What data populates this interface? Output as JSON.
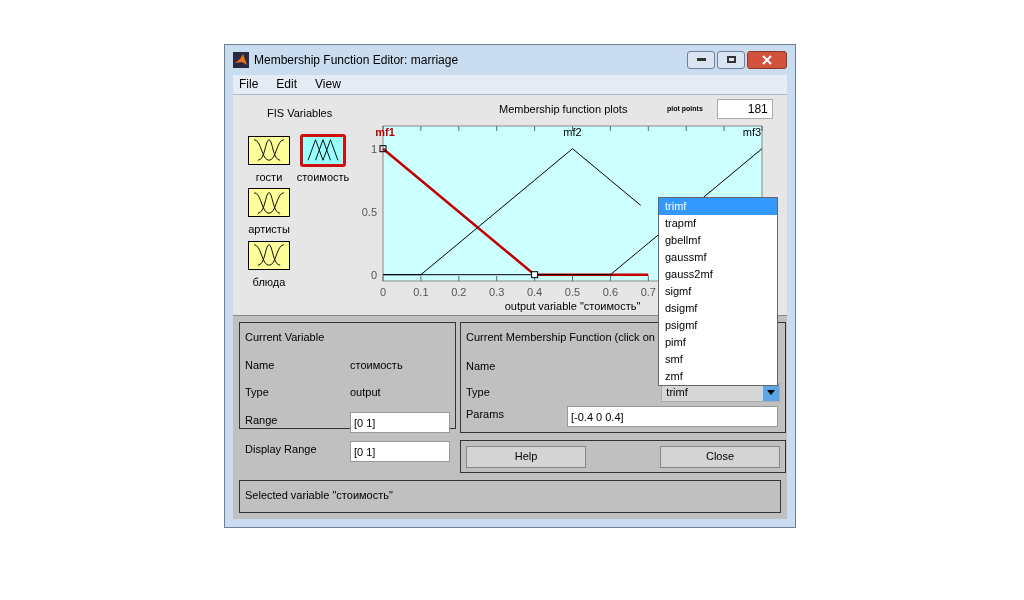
{
  "window": {
    "title": "Membership Function Editor: marriage"
  },
  "menu": [
    "File",
    "Edit",
    "View"
  ],
  "fis_variables": {
    "title": "FIS Variables",
    "items": [
      {
        "name": "гости",
        "kind": "input",
        "selected": false
      },
      {
        "name": "стоимость",
        "kind": "output",
        "selected": true
      },
      {
        "name": "артисты",
        "kind": "input",
        "selected": false
      },
      {
        "name": "блюда",
        "kind": "input",
        "selected": false
      }
    ]
  },
  "plot": {
    "title": "Membership function plots",
    "plot_points_label": "plot points",
    "plot_points": "181",
    "chart_data": {
      "type": "line",
      "xlabel": "output variable \"стоимость\"",
      "x": [
        0,
        0.1,
        0.4,
        0.5,
        0.6,
        0.68,
        0.7,
        0.9,
        1
      ],
      "xlim": [
        0,
        1
      ],
      "ylim": [
        -0.05,
        1.18
      ],
      "xticks": [
        0,
        0.1,
        0.2,
        0.3,
        0.4,
        0.5,
        0.6,
        0.7
      ],
      "yticks": [
        0,
        0.5,
        1
      ],
      "series": [
        {
          "name": "mf1",
          "color": "#c00000",
          "values": [
            1,
            0.75,
            0,
            0,
            0,
            0,
            0,
            null,
            null
          ]
        },
        {
          "name": "mf2",
          "color": "#000000",
          "values": [
            0,
            0,
            0.75,
            1,
            0.75,
            0.55,
            null,
            null,
            null
          ]
        },
        {
          "name": "mf3",
          "color": "#000000",
          "values": [
            0,
            0,
            0,
            0,
            0,
            0.2,
            0.25,
            0.75,
            1
          ]
        }
      ]
    },
    "curves": [
      {
        "selected": true
      },
      {
        "selected": false
      },
      {
        "selected": false
      }
    ]
  },
  "current_variable": {
    "title": "Current Variable",
    "rows": [
      {
        "label": "Name",
        "value": "стоимость",
        "kind": "text"
      },
      {
        "label": "Type",
        "value": "output",
        "kind": "text"
      },
      {
        "label": "Range",
        "value": "[0 1]",
        "kind": "field"
      },
      {
        "label": "Display Range",
        "value": "[0 1]",
        "kind": "field"
      }
    ]
  },
  "current_mf": {
    "title": "Current Membership Function (click on",
    "name_label": "Name",
    "type_label": "Type",
    "type_value": "trimf",
    "params_label": "Params",
    "params_value": "[-0.4 0 0.4]"
  },
  "type_dropdown": [
    {
      "label": "trimf",
      "selected": true
    },
    {
      "label": "trapmf",
      "selected": false
    },
    {
      "label": "gbellmf",
      "selected": false
    },
    {
      "label": "gaussmf",
      "selected": false
    },
    {
      "label": "gauss2mf",
      "selected": false
    },
    {
      "label": "sigmf",
      "selected": false
    },
    {
      "label": "dsigmf",
      "selected": false
    },
    {
      "label": "psigmf",
      "selected": false
    },
    {
      "label": "pimf",
      "selected": false
    },
    {
      "label": "smf",
      "selected": false
    },
    {
      "label": "zmf",
      "selected": false
    }
  ],
  "buttons": [
    "Help",
    "Close"
  ],
  "status": "Selected variable \"стоимость\""
}
